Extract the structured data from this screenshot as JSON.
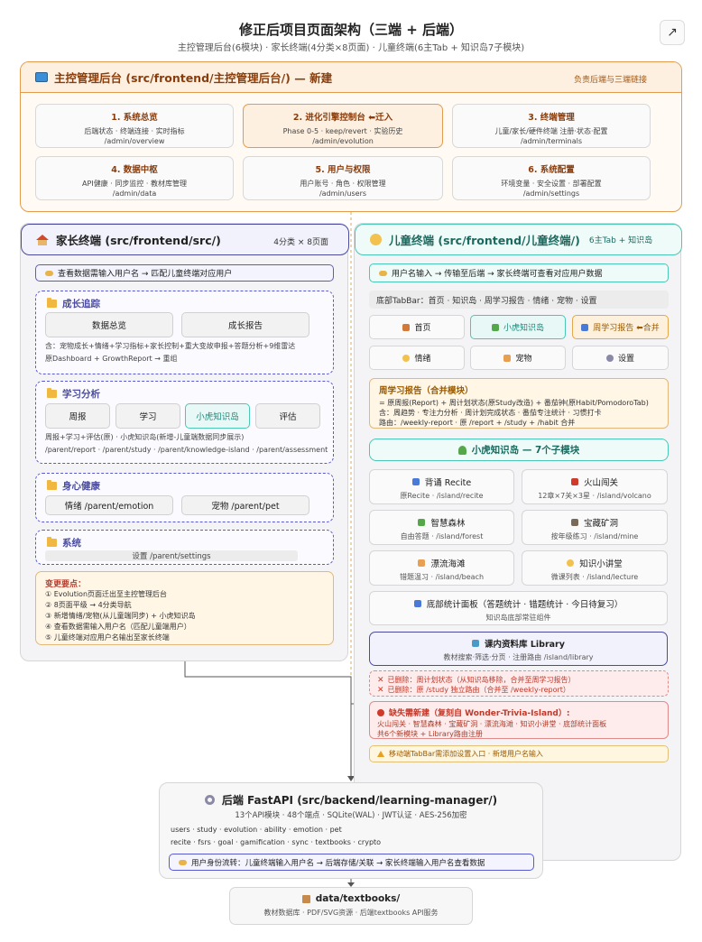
{
  "title": "修正后项目页面架构（三端 + 后端）",
  "subtitle": "主控管理后台(6模块) · 家长终端(4分类×8页面) · 儿童终端(6主Tab + 知识岛7子模块)",
  "expand_icon": "↗",
  "admin": {
    "title": "主控管理后台 (src/frontend/主控管理后台/) — 新建",
    "note": "负责后端与三端链接",
    "modules": [
      {
        "title": "1. 系统总览",
        "desc1": "后端状态 · 终端连接 · 实时指标",
        "desc2": "/admin/overview"
      },
      {
        "title": "2. 进化引擎控制台 ⬅迁入",
        "desc1": "Phase 0-5 · keep/revert · 实验历史",
        "desc2": "/admin/evolution"
      },
      {
        "title": "3. 终端管理",
        "desc1": "儿童/家长/硬件终端 注册·状态·配置",
        "desc2": "/admin/terminals"
      },
      {
        "title": "4. 数据中枢",
        "desc1": "API健康 · 同步监控 · 教材库管理",
        "desc2": "/admin/data"
      },
      {
        "title": "5. 用户与权限",
        "desc1": "用户账号 · 角色 · 权限管理",
        "desc2": "/admin/users"
      },
      {
        "title": "6. 系统配置",
        "desc1": "环境变量 · 安全设置 · 部署配置",
        "desc2": "/admin/settings"
      }
    ]
  },
  "parent": {
    "title": "家长终端 (src/frontend/src/)",
    "badge": "4分类 × 8页面",
    "flow": "查看数据需输入用户名 → 匹配儿童终端对应用户",
    "growth": {
      "title": "成长追踪",
      "buttons": [
        "数据总览",
        "成长报告"
      ],
      "note1": "含：宠物成长+情绪+学习指标+家长控制+重大变故申报+答题分析+9维雷达",
      "note2": "原Dashboard + GrowthReport → 重组"
    },
    "study": {
      "title": "学习分析",
      "buttons": [
        "周报",
        "学习",
        "小虎知识岛",
        "评估"
      ],
      "note1": "周报+学习+评估(原) · 小虎知识岛(新增-儿童端数据同步展示)",
      "note2": "/parent/report · /parent/study · /parent/knowledge-island · /parent/assessment"
    },
    "health": {
      "title": "身心健康",
      "buttons": [
        "情绪 /parent/emotion",
        "宠物 /parent/pet"
      ]
    },
    "system": {
      "title": "系统",
      "settings": "设置 /parent/settings"
    },
    "changes": {
      "title": "变更要点：",
      "items": [
        "① Evolution页面迁出至主控管理后台",
        "② 8页面平级 → 4分类导航",
        "③ 新增情绪/宠物(从儿童端同步) + 小虎知识岛",
        "④ 查看数据需输入用户名（匹配儿童端用户）",
        "⑤ 儿童终端对应用户名输出至家长终端"
      ]
    }
  },
  "child": {
    "title": "儿童终端 (src/frontend/儿童终端/)",
    "badge": "6主Tab + 知识岛",
    "flow": "用户名输入 → 传输至后端 → 家长终端可查看对应用户数据",
    "tabbar": "底部TabBar：首页 · 知识岛 · 周学习报告 · 情绪 · 宠物 · 设置",
    "tabs": [
      "首页",
      "小虎知识岛",
      "周学习报告 ⬅合并",
      "情绪",
      "宠物",
      "设置"
    ],
    "weekly": {
      "title": "周学习报告（合并模块）",
      "l1": "= 原周报(Report) + 周计划状态(原Study改造) + 番茄钟(原Habit/PomodoroTab)",
      "l2": "含：周趋势 · 专注力分析 · 周计划完成状态 · 番茄专注统计 · 习惯打卡",
      "l3": "路由：/weekly-report · 原 /report + /study + /habit 合并"
    },
    "island_title": "小虎知识岛 — 7个子模块",
    "cards": [
      {
        "title": "背诵 Recite",
        "desc": "原Recite · /island/recite"
      },
      {
        "title": "火山闯关",
        "desc": "12章×7关×3星 · /island/volcano"
      },
      {
        "title": "智慧森林",
        "desc": "自由答题 · /island/forest"
      },
      {
        "title": "宝藏矿洞",
        "desc": "按年级练习 · /island/mine"
      },
      {
        "title": "漂流海滩",
        "desc": "错题温习 · /island/beach"
      },
      {
        "title": "知识小讲堂",
        "desc": "微课列表 · /island/lecture"
      }
    ],
    "stats": {
      "title": "底部统计面板（答题统计 · 错题统计 · 今日待复习）",
      "desc": "知识岛底部常驻组件"
    },
    "library": {
      "title": "课内资料库 Library",
      "desc": "教材搜索·筛选·分页 · 注册路由 /island/library"
    },
    "deleted": [
      "已删除：周计划状态（从知识岛移除，合并至周学习报告）",
      "已删除：原 /study 独立路由（合并至 /weekly-report）"
    ],
    "missing": {
      "title": "缺失需新建（复刻自 Wonder-Trivia-Island）:",
      "l1": "火山闯关 · 智慧森林 · 宝藏矿洞 · 漂流海滩 · 知识小讲堂 · 底部统计面板",
      "l2": "共6个新模块 + Library路由注册"
    },
    "warn": "移动端TabBar需添加设置入口 · 新增用户名输入"
  },
  "backend": {
    "title": "后端 FastAPI (src/backend/learning-manager/)",
    "desc": "13个API模块 · 48个端点 · SQLite(WAL) · JWT认证 · AES-256加密",
    "modules1": "users · study · evolution · ability · emotion · pet",
    "modules2": "recite · fsrs · goal · gamification · sync · textbooks · crypto",
    "flow": "用户身份流转：儿童终端输入用户名 → 后端存储/关联 → 家长终端输入用户名查看数据"
  },
  "data_store": {
    "title": "data/textbooks/",
    "desc": "教材数据库 · PDF/SVG资源 · 后端textbooks API服务"
  },
  "colors": {
    "admin_border": "#e39b4f",
    "parent_border": "#4b4ba0",
    "child_border": "#4ac7b5",
    "alert": "#c0392b"
  }
}
